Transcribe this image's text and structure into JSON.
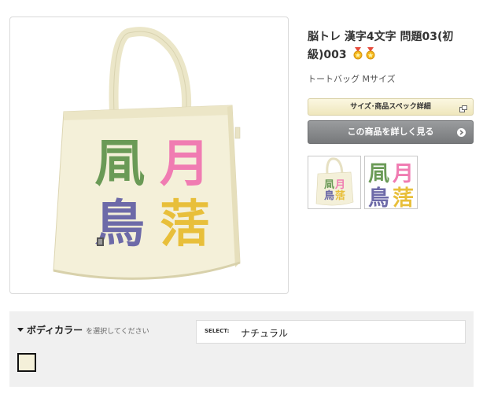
{
  "product": {
    "title": "脳トレ 漢字4文字 問題03(初級)003",
    "subtitle": "トートバッグ Mサイズ",
    "medal_icons": [
      "medal-icon",
      "medal-icon"
    ]
  },
  "design": {
    "chars": [
      "凬",
      "月",
      "鳥",
      "萿"
    ],
    "char_colors": [
      "#6a9a56",
      "#f07cb2",
      "#6d6aa8",
      "#e8bf3a"
    ],
    "bag_color": "#f4f0d9"
  },
  "buttons": {
    "spec_label": "サイズ･商品スペック詳細",
    "detail_label": "この商品を詳しく見る"
  },
  "options": {
    "section_label": "ボディカラー",
    "section_hint": "を選択してください",
    "select_label": "SELECT:",
    "selected_value": "ナチュラル",
    "swatches": [
      {
        "name": "ナチュラル",
        "color": "#f4f0d9"
      }
    ]
  }
}
